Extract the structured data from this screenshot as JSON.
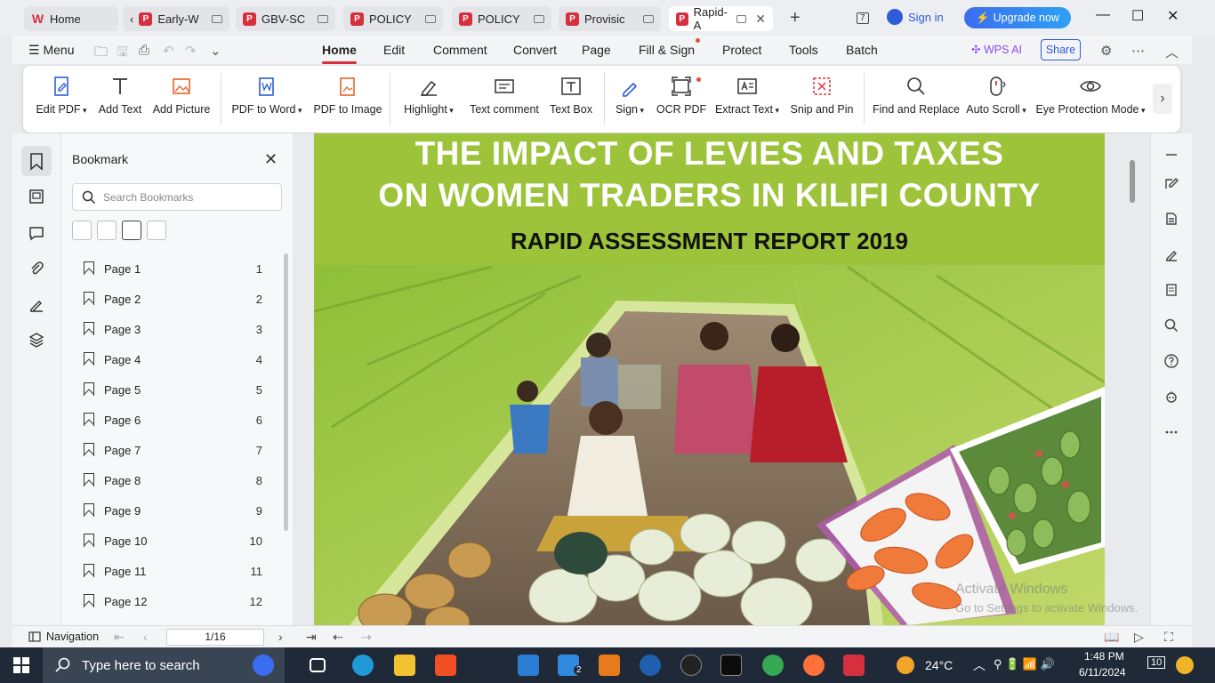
{
  "tabs": [
    {
      "label": "Home",
      "kind": "home"
    },
    {
      "label": "Early-W",
      "kind": "doc"
    },
    {
      "label": "GBV-SC",
      "kind": "doc"
    },
    {
      "label": "POLICY",
      "kind": "doc"
    },
    {
      "label": "POLICY",
      "kind": "doc"
    },
    {
      "label": "Provisic",
      "kind": "doc"
    },
    {
      "label": "Rapid-A",
      "kind": "doc",
      "active": true
    }
  ],
  "titlebar": {
    "sign_in": "Sign in",
    "upgrade": "Upgrade now",
    "badge": "7"
  },
  "menu": {
    "menu_label": "Menu",
    "items": [
      "Home",
      "Edit",
      "Comment",
      "Convert",
      "Page",
      "Fill & Sign",
      "Protect",
      "Tools",
      "Batch"
    ],
    "active": "Home",
    "wps_ai": "WPS AI",
    "share": "Share"
  },
  "ribbon": [
    {
      "label": "Edit PDF",
      "icon": "edit-pdf-icon",
      "dropdown": true
    },
    {
      "label": "Add Text",
      "icon": "add-text-icon"
    },
    {
      "label": "Add Picture",
      "icon": "add-picture-icon"
    },
    {
      "label": "PDF to Word",
      "icon": "pdf-to-word-icon",
      "dropdown": true
    },
    {
      "label": "PDF to Image",
      "icon": "pdf-to-image-icon"
    },
    {
      "label": "Highlight",
      "icon": "highlight-icon",
      "dropdown": true
    },
    {
      "label": "Text comment",
      "icon": "text-comment-icon"
    },
    {
      "label": "Text Box",
      "icon": "text-box-icon"
    },
    {
      "label": "Sign",
      "icon": "sign-icon",
      "dropdown": true
    },
    {
      "label": "OCR PDF",
      "icon": "ocr-icon"
    },
    {
      "label": "Extract Text",
      "icon": "extract-text-icon",
      "dropdown": true
    },
    {
      "label": "Snip and Pin",
      "icon": "snip-icon"
    },
    {
      "label": "Find and Replace",
      "icon": "find-replace-icon"
    },
    {
      "label": "Auto Scroll",
      "icon": "auto-scroll-icon",
      "dropdown": true
    },
    {
      "label": "Eye Protection Mode",
      "icon": "eye-icon",
      "dropdown": true
    }
  ],
  "bookmark": {
    "title": "Bookmark",
    "search_placeholder": "Search Bookmarks",
    "items": [
      {
        "label": "Page 1",
        "num": "1"
      },
      {
        "label": "Page 2",
        "num": "2"
      },
      {
        "label": "Page 3",
        "num": "3"
      },
      {
        "label": "Page 4",
        "num": "4"
      },
      {
        "label": "Page 5",
        "num": "5"
      },
      {
        "label": "Page 6",
        "num": "6"
      },
      {
        "label": "Page 7",
        "num": "7"
      },
      {
        "label": "Page 8",
        "num": "8"
      },
      {
        "label": "Page 9",
        "num": "9"
      },
      {
        "label": "Page 10",
        "num": "10"
      },
      {
        "label": "Page 11",
        "num": "11"
      },
      {
        "label": "Page 12",
        "num": "12"
      }
    ]
  },
  "document": {
    "title_line1": "THE IMPACT OF LEVIES AND TAXES",
    "title_line2": "ON WOMEN TRADERS IN KILIFI COUNTY",
    "subtitle": "RAPID ASSESSMENT REPORT 2019",
    "watermark_line1": "Activate Windows",
    "watermark_line2": "Go to Settings to activate Windows."
  },
  "status": {
    "navigation": "Navigation",
    "page_indicator": "1/16"
  },
  "taskbar": {
    "search_placeholder": "Type here to search",
    "weather": "24°C",
    "time": "1:48 PM",
    "date": "6/11/2024",
    "notifications": "10",
    "mail_badge": "2"
  },
  "colors": {
    "accent": "#d6303e",
    "brand_blue": "#2e5bd8",
    "cover_green": "#9cc33a"
  }
}
